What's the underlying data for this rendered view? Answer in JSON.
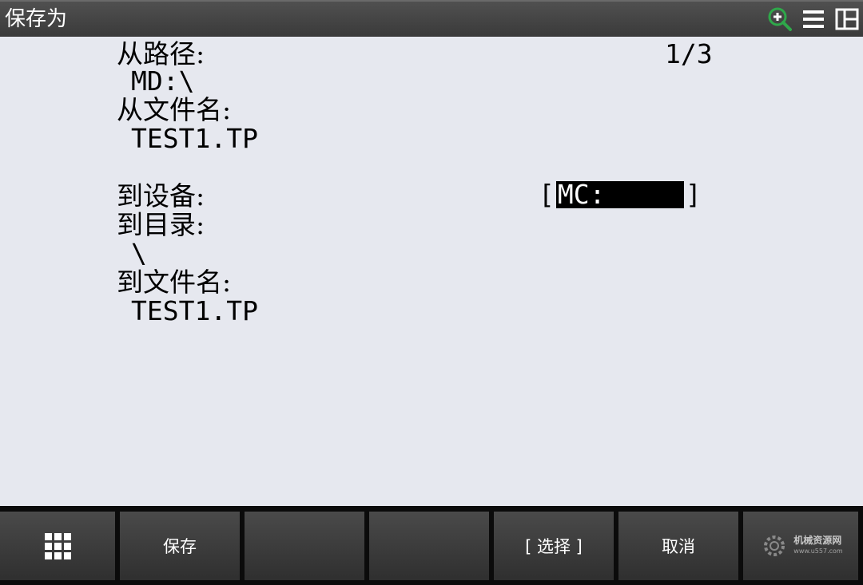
{
  "titlebar": {
    "title": "保存为",
    "icons": [
      "zoom-in-icon",
      "menu-icon",
      "split-window-icon"
    ]
  },
  "form": {
    "from_path_label": "从路径:",
    "page_indicator": "1/3",
    "from_path_value": "MD:\\",
    "from_filename_label": "从文件名:",
    "from_filename_value": "TEST1.TP",
    "to_device_label": "到设备:",
    "to_device_open_bracket": "[",
    "to_device_value": "MC:",
    "to_device_close_bracket": "]",
    "to_directory_label": "到目录:",
    "to_directory_value": "\\",
    "to_filename_label": "到文件名:",
    "to_filename_value": "TEST1.TP"
  },
  "function_keys": {
    "f1": "保存",
    "f2": "",
    "f3": "",
    "f4": "[ 选择 ]",
    "f5": "取消"
  },
  "watermark": {
    "main": "机械资源网",
    "sub": "www.u557.com"
  },
  "colors": {
    "titlebar": "#444444",
    "content_bg": "#e6e8ef",
    "zoom_icon": "#2fa84a",
    "highlight_bg": "#000000",
    "highlight_fg": "#ffffff"
  }
}
